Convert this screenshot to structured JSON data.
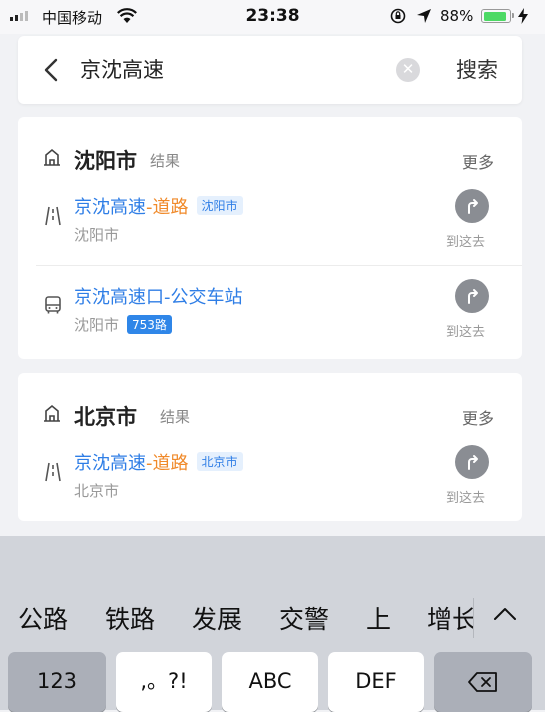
{
  "status_bar": {
    "carrier": "中国移动",
    "time": "23:38",
    "battery": "88%",
    "battery_level": 0.88
  },
  "search": {
    "query": "京沈高速",
    "submit_label": "搜索"
  },
  "groups": [
    {
      "city": "沈阳市",
      "results_label": "结果",
      "more_label": "更多",
      "items": [
        {
          "name": "京沈高速",
          "sep": "-",
          "type": "道路",
          "tag": "沈阳市",
          "sub": "沈阳市",
          "nav_label": "到这去"
        },
        {
          "name": "京沈高速口",
          "sep": "-",
          "type": "公交车站",
          "tag": "",
          "sub": "沈阳市",
          "route": "753路",
          "nav_label": "到这去"
        }
      ]
    },
    {
      "city": "北京市",
      "results_label": "结果",
      "more_label": "更多",
      "items": [
        {
          "name": "京沈高速",
          "sep": "-",
          "type": "道路",
          "tag": "北京市",
          "sub": "北京市",
          "nav_label": "到这去"
        }
      ]
    }
  ],
  "keyboard": {
    "suggestions": [
      "公路",
      "铁路",
      "发展",
      "交警",
      "上",
      "增长"
    ],
    "keys": [
      "123",
      ",。?!",
      "ABC",
      "DEF"
    ]
  },
  "colors": {
    "accent_blue": "#2f7ee6",
    "type_orange": "#f08a2a",
    "battery_green": "#4cd964"
  }
}
